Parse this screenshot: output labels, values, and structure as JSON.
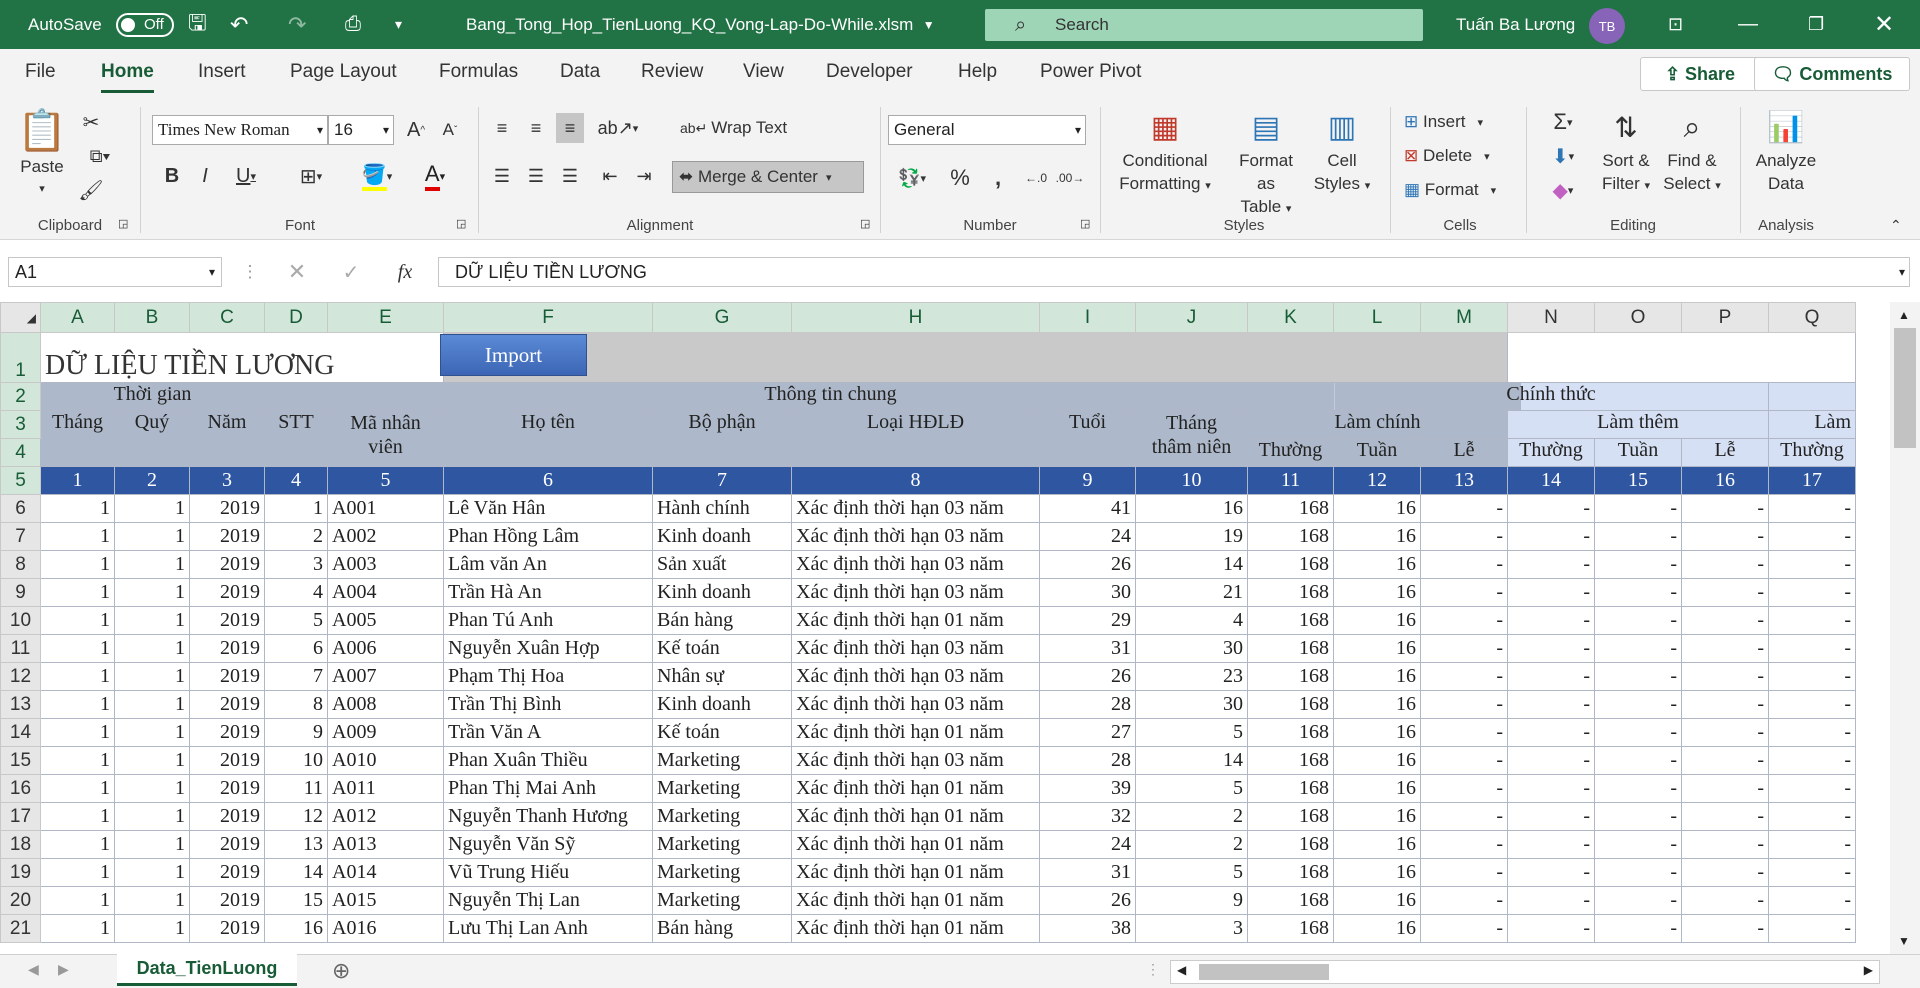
{
  "titlebar": {
    "autosave_label": "AutoSave",
    "autosave_state": "Off",
    "filename": "Bang_Tong_Hop_TienLuong_KQ_Vong-Lap-Do-While.xlsm",
    "search_placeholder": "Search",
    "user_name": "Tuấn Ba Lương",
    "user_initials": "TB"
  },
  "tabs": [
    "File",
    "Home",
    "Insert",
    "Page Layout",
    "Formulas",
    "Data",
    "Review",
    "View",
    "Developer",
    "Help",
    "Power Pivot"
  ],
  "active_tab": "Home",
  "share_label": "Share",
  "comments_label": "Comments",
  "ribbon": {
    "clipboard": {
      "paste": "Paste",
      "group": "Clipboard"
    },
    "font": {
      "name": "Times New Roman",
      "size": "16",
      "group": "Font"
    },
    "alignment": {
      "wrap": "Wrap Text",
      "merge": "Merge & Center",
      "group": "Alignment"
    },
    "number": {
      "format": "General",
      "group": "Number"
    },
    "styles": {
      "cond": "Conditional",
      "cond2": "Formatting",
      "fmt_table": "Format as",
      "fmt_table2": "Table",
      "cell_styles": "Cell",
      "cell_styles2": "Styles",
      "group": "Styles"
    },
    "cells": {
      "insert": "Insert",
      "delete": "Delete",
      "format": "Format",
      "group": "Cells"
    },
    "editing": {
      "sort": "Sort &",
      "sort2": "Filter",
      "find": "Find &",
      "find2": "Select",
      "group": "Editing"
    },
    "analysis": {
      "analyze": "Analyze",
      "analyze2": "Data",
      "group": "Analysis"
    }
  },
  "formula_bar": {
    "name_box": "A1",
    "formula": "DỮ LIỆU TIỀN LƯƠNG"
  },
  "columns": [
    "A",
    "B",
    "C",
    "D",
    "E",
    "F",
    "G",
    "H",
    "I",
    "J",
    "K",
    "L",
    "M",
    "N",
    "O",
    "P",
    "Q"
  ],
  "sheet": {
    "title": "DỮ LIỆU TIỀN LƯƠNG",
    "import_button": "Import",
    "group_time": "Thời gian",
    "group_info": "Thông tin chung",
    "group_official": "Chính thức",
    "sub_main": "Làm chính",
    "sub_extra": "Làm thêm",
    "sub_extra2": "Làm",
    "h_month": "Tháng",
    "h_quarter": "Quý",
    "h_year": "Năm",
    "h_stt": "STT",
    "h_empid": "Mã nhân viên",
    "h_empid1": "Mã nhân",
    "h_empid2": "viên",
    "h_name": "Họ tên",
    "h_dept": "Bộ phận",
    "h_contract": "Loại HĐLĐ",
    "h_age": "Tuổi",
    "h_senior1": "Tháng",
    "h_senior2": "thâm niên",
    "h_normal": "Thường",
    "h_week": "Tuần",
    "h_holiday": "Lễ",
    "h_tail": "T",
    "numbers": [
      "1",
      "2",
      "3",
      "4",
      "5",
      "6",
      "7",
      "8",
      "9",
      "10",
      "11",
      "12",
      "13",
      "14",
      "15",
      "16",
      "17"
    ],
    "rows": [
      [
        "1",
        "1",
        "2019",
        "1",
        "A001",
        "Lê Văn Hân",
        "Hành chính",
        "Xác định thời hạn 03 năm",
        "41",
        "16",
        "168",
        "16",
        "-",
        "-",
        "-",
        "-",
        "-"
      ],
      [
        "1",
        "1",
        "2019",
        "2",
        "A002",
        "Phan Hồng Lâm",
        "Kinh doanh",
        "Xác định thời hạn 03 năm",
        "24",
        "19",
        "168",
        "16",
        "-",
        "-",
        "-",
        "-",
        "-"
      ],
      [
        "1",
        "1",
        "2019",
        "3",
        "A003",
        "Lâm văn An",
        "Sản xuất",
        "Xác định thời hạn 03 năm",
        "26",
        "14",
        "168",
        "16",
        "-",
        "-",
        "-",
        "-",
        "-"
      ],
      [
        "1",
        "1",
        "2019",
        "4",
        "A004",
        "Trần Hà An",
        "Kinh doanh",
        "Xác định thời hạn 03 năm",
        "30",
        "21",
        "168",
        "16",
        "-",
        "-",
        "-",
        "-",
        "-"
      ],
      [
        "1",
        "1",
        "2019",
        "5",
        "A005",
        "Phan Tú Anh",
        "Bán hàng",
        "Xác định thời hạn 01 năm",
        "29",
        "4",
        "168",
        "16",
        "-",
        "-",
        "-",
        "-",
        "-"
      ],
      [
        "1",
        "1",
        "2019",
        "6",
        "A006",
        "Nguyễn Xuân Hợp",
        "Kế toán",
        "Xác định thời hạn 03 năm",
        "31",
        "30",
        "168",
        "16",
        "-",
        "-",
        "-",
        "-",
        "-"
      ],
      [
        "1",
        "1",
        "2019",
        "7",
        "A007",
        "Phạm Thị Hoa",
        "Nhân sự",
        "Xác định thời hạn 03 năm",
        "26",
        "23",
        "168",
        "16",
        "-",
        "-",
        "-",
        "-",
        "-"
      ],
      [
        "1",
        "1",
        "2019",
        "8",
        "A008",
        "Trần Thị Bình",
        "Kinh doanh",
        "Xác định thời hạn 03 năm",
        "28",
        "30",
        "168",
        "16",
        "-",
        "-",
        "-",
        "-",
        "-"
      ],
      [
        "1",
        "1",
        "2019",
        "9",
        "A009",
        "Trần Văn A",
        "Kế toán",
        "Xác định thời hạn 01 năm",
        "27",
        "5",
        "168",
        "16",
        "-",
        "-",
        "-",
        "-",
        "-"
      ],
      [
        "1",
        "1",
        "2019",
        "10",
        "A010",
        "Phan Xuân Thiều",
        "Marketing",
        "Xác định thời hạn 03 năm",
        "28",
        "14",
        "168",
        "16",
        "-",
        "-",
        "-",
        "-",
        "-"
      ],
      [
        "1",
        "1",
        "2019",
        "11",
        "A011",
        "Phan Thị Mai Anh",
        "Marketing",
        "Xác định thời hạn 01 năm",
        "39",
        "5",
        "168",
        "16",
        "-",
        "-",
        "-",
        "-",
        "-"
      ],
      [
        "1",
        "1",
        "2019",
        "12",
        "A012",
        "Nguyễn Thanh Hương",
        "Marketing",
        "Xác định thời hạn 01 năm",
        "32",
        "2",
        "168",
        "16",
        "-",
        "-",
        "-",
        "-",
        "-"
      ],
      [
        "1",
        "1",
        "2019",
        "13",
        "A013",
        "Nguyễn Văn Sỹ",
        "Marketing",
        "Xác định thời hạn 01 năm",
        "24",
        "2",
        "168",
        "16",
        "-",
        "-",
        "-",
        "-",
        "-"
      ],
      [
        "1",
        "1",
        "2019",
        "14",
        "A014",
        "Vũ Trung Hiếu",
        "Marketing",
        "Xác định thời hạn 01 năm",
        "31",
        "5",
        "168",
        "16",
        "-",
        "-",
        "-",
        "-",
        "-"
      ],
      [
        "1",
        "1",
        "2019",
        "15",
        "A015",
        "Nguyễn Thị Lan",
        "Marketing",
        "Xác định thời hạn 01 năm",
        "26",
        "9",
        "168",
        "16",
        "-",
        "-",
        "-",
        "-",
        "-"
      ],
      [
        "1",
        "1",
        "2019",
        "16",
        "A016",
        "Lưu Thị Lan Anh",
        "Bán hàng",
        "Xác định thời hạn 01 năm",
        "38",
        "3",
        "168",
        "16",
        "-",
        "-",
        "-",
        "-",
        "-"
      ]
    ]
  },
  "sheet_tab": "Data_TienLuong"
}
